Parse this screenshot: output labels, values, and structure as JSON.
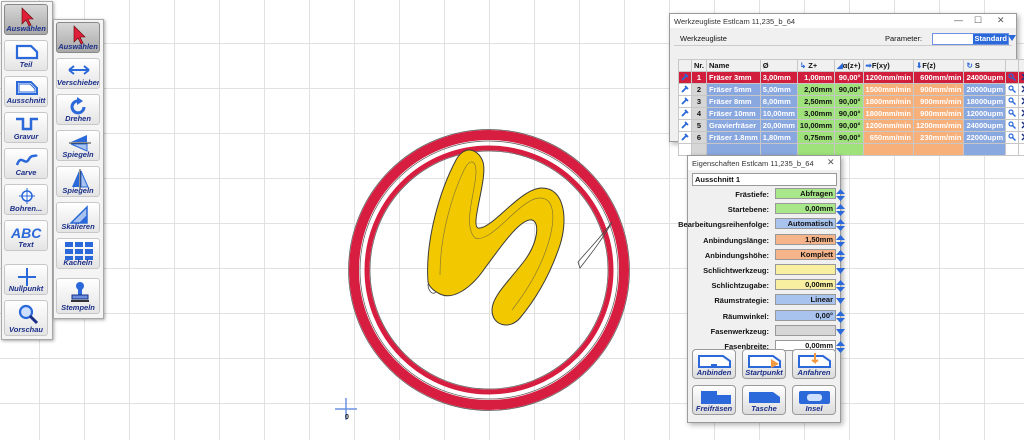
{
  "left_toolbar": {
    "items": [
      {
        "label": "Auswählen",
        "icon": "cursor-arrow-icon",
        "active": true
      },
      {
        "label": "Teil",
        "icon": "part-outline-icon"
      },
      {
        "label": "Ausschnitt",
        "icon": "cutout-icon"
      },
      {
        "label": "Gravur",
        "icon": "engrave-icon"
      },
      {
        "label": "Carve",
        "icon": "carve-wave-icon"
      },
      {
        "label": "Bohren...",
        "icon": "drill-crosshair-icon"
      },
      {
        "label": "Text",
        "icon": "text-abc-icon"
      },
      {
        "label": "Nullpunkt",
        "icon": "origin-cross-icon"
      },
      {
        "label": "Vorschau",
        "icon": "magnifier-icon"
      }
    ]
  },
  "second_toolbar": {
    "items": [
      {
        "label": "Auswählen",
        "icon": "cursor-arrow-icon",
        "active": true
      },
      {
        "label": "Verschieben",
        "icon": "move-arrows-icon"
      },
      {
        "label": "Drehen",
        "icon": "rotate-icon"
      },
      {
        "label": "Spiegeln",
        "icon": "mirror-horizontal-icon"
      },
      {
        "label": "Spiegeln",
        "icon": "mirror-vertical-icon"
      },
      {
        "label": "Skalieren",
        "icon": "scale-triangle-icon"
      },
      {
        "label": "Kacheln",
        "icon": "tile-grid-icon"
      },
      {
        "label": "Stempeln",
        "icon": "stamp-icon"
      }
    ]
  },
  "canvas": {
    "origin_label": "0",
    "ring_color": "#d81e40",
    "letter_color": "#f2c900"
  },
  "tool_window": {
    "title": "Werkzeugliste Estlcam 11,235_b_64",
    "menu_label": "Werkzeugliste",
    "param_label": "Parameter:",
    "param_value": "Standard",
    "headers": [
      "Nr.",
      "Name",
      "Ø",
      "Z+",
      "α(z+)",
      "F(xy)",
      "F(z)",
      "S"
    ],
    "rows": [
      {
        "nr": "1",
        "name": "Fräser 3mm",
        "d": "3,00mm",
        "z": "1,00mm",
        "a": "90,00°",
        "fxy": "1200mm/min",
        "fz": "600mm/min",
        "s": "24000upm",
        "selected": true
      },
      {
        "nr": "2",
        "name": "Fräser 5mm",
        "d": "5,00mm",
        "z": "2,00mm",
        "a": "90,00°",
        "fxy": "1500mm/min",
        "fz": "900mm/min",
        "s": "20000upm"
      },
      {
        "nr": "3",
        "name": "Fräser 8mm",
        "d": "8,00mm",
        "z": "2,50mm",
        "a": "90,00°",
        "fxy": "1800mm/min",
        "fz": "900mm/min",
        "s": "18000upm"
      },
      {
        "nr": "4",
        "name": "Fräser 10mm",
        "d": "10,00mm",
        "z": "3,00mm",
        "a": "90,00°",
        "fxy": "1800mm/min",
        "fz": "900mm/min",
        "s": "12000upm"
      },
      {
        "nr": "5",
        "name": "Gravierfräser",
        "d": "20,00mm",
        "z": "10,00mm",
        "a": "90,00°",
        "fxy": "1200mm/min",
        "fz": "1200mm/min",
        "s": "24000upm"
      },
      {
        "nr": "6",
        "name": "Fräser 1.8mm",
        "d": "1,80mm",
        "z": "0,75mm",
        "a": "90,00°",
        "fxy": "650mm/min",
        "fz": "230mm/min",
        "s": "22000upm"
      }
    ]
  },
  "props_window": {
    "title": "Eigenschaften Estlcam 11,235_b_64",
    "name_value": "Ausschnitt 1",
    "rows": [
      {
        "label": "Frästiefe:",
        "value": "Abfragen",
        "color": "#a8e88a",
        "ctl": "spin"
      },
      {
        "label": "Startebene:",
        "value": "0,00mm",
        "color": "#a8e88a",
        "ctl": "spin"
      },
      {
        "label": "Bearbeitungsreihenfolge:",
        "value": "Automatisch",
        "color": "#a9c3ef",
        "ctl": "spin"
      },
      {
        "label": "Anbindungslänge:",
        "value": "1,50mm",
        "color": "#f5b48a",
        "ctl": "spin"
      },
      {
        "label": "Anbindungshöhe:",
        "value": "Komplett",
        "color": "#f5b48a",
        "ctl": "spin"
      },
      {
        "label": "Schlichtwerkzeug:",
        "value": "",
        "color": "#f8f0a0",
        "ctl": "drop"
      },
      {
        "label": "Schlichtzugabe:",
        "value": "0,00mm",
        "color": "#f8f0a0",
        "ctl": "spin"
      },
      {
        "label": "Räumstrategie:",
        "value": "Linear",
        "color": "#a9c3ef",
        "ctl": "drop"
      },
      {
        "label": "Räumwinkel:",
        "value": "0,00°",
        "color": "#a9c3ef",
        "ctl": "spin"
      },
      {
        "label": "Fasenwerkzeug:",
        "value": "",
        "color": "#d6d6d6",
        "ctl": "drop"
      },
      {
        "label": "Fasenbreite:",
        "value": "0,00mm",
        "color": "#ffffff",
        "ctl": "spin"
      }
    ],
    "buttons": [
      {
        "label": "Anbinden",
        "icon": "attach-icon"
      },
      {
        "label": "Startpunkt",
        "icon": "startpoint-icon"
      },
      {
        "label": "Anfahren",
        "icon": "approach-icon"
      },
      {
        "label": "Freifräsen",
        "icon": "freemill-icon"
      },
      {
        "label": "Tasche",
        "icon": "pocket-icon"
      },
      {
        "label": "Insel",
        "icon": "island-icon"
      }
    ]
  }
}
